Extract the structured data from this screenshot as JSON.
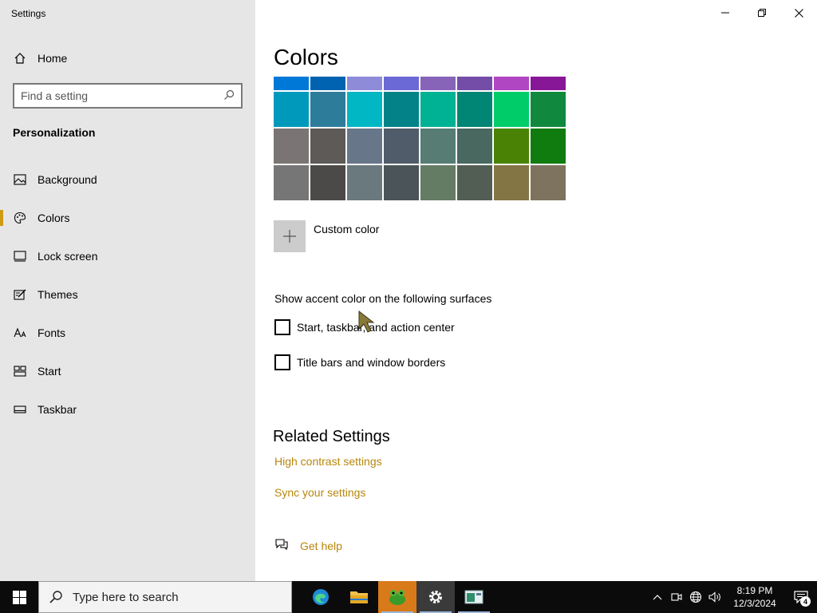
{
  "window": {
    "title": "Settings"
  },
  "sidebar": {
    "home_label": "Home",
    "search_placeholder": "Find a setting",
    "section_title": "Personalization",
    "items": [
      {
        "label": "Background",
        "icon": "picture-icon",
        "active": false
      },
      {
        "label": "Colors",
        "icon": "palette-icon",
        "active": true
      },
      {
        "label": "Lock screen",
        "icon": "lock-screen-icon",
        "active": false
      },
      {
        "label": "Themes",
        "icon": "themes-icon",
        "active": false
      },
      {
        "label": "Fonts",
        "icon": "fonts-icon",
        "active": false
      },
      {
        "label": "Start",
        "icon": "start-icon",
        "active": false
      },
      {
        "label": "Taskbar",
        "icon": "taskbar-icon",
        "active": false
      }
    ],
    "accent_color": "#d09a12"
  },
  "main": {
    "title": "Colors",
    "swatches": {
      "top_row": [
        "#0078d7",
        "#0063b1",
        "#8e8cd8",
        "#6b69d6",
        "#8764b8",
        "#744da9",
        "#b146c2",
        "#881798"
      ],
      "rows": [
        [
          "#0099bc",
          "#2d7d9a",
          "#00b7c3",
          "#038387",
          "#00b294",
          "#018574",
          "#00cc6a",
          "#10893e"
        ],
        [
          "#7a7574",
          "#5d5a58",
          "#68768a",
          "#515c6b",
          "#567c73",
          "#486860",
          "#498205",
          "#107c10"
        ],
        [
          "#767676",
          "#4c4a48",
          "#69797e",
          "#4a5459",
          "#647c64",
          "#525e54",
          "#847545",
          "#7e735f"
        ]
      ]
    },
    "custom_color_label": "Custom color",
    "surfaces_label": "Show accent color on the following surfaces",
    "checkboxes": [
      {
        "label": "Start, taskbar, and action center",
        "checked": false
      },
      {
        "label": "Title bars and window borders",
        "checked": false
      }
    ],
    "related_title": "Related Settings",
    "links": [
      "High contrast settings",
      "Sync your settings"
    ],
    "help_label": "Get help",
    "link_color": "#b8860b"
  },
  "taskbar": {
    "search_placeholder": "Type here to search",
    "apps": [
      "edge-icon",
      "file-explorer-icon",
      "app-frog-icon",
      "settings-icon",
      "app-window-icon"
    ],
    "clock_time": "8:19 PM",
    "clock_date": "12/3/2024",
    "notification_count": "4"
  }
}
